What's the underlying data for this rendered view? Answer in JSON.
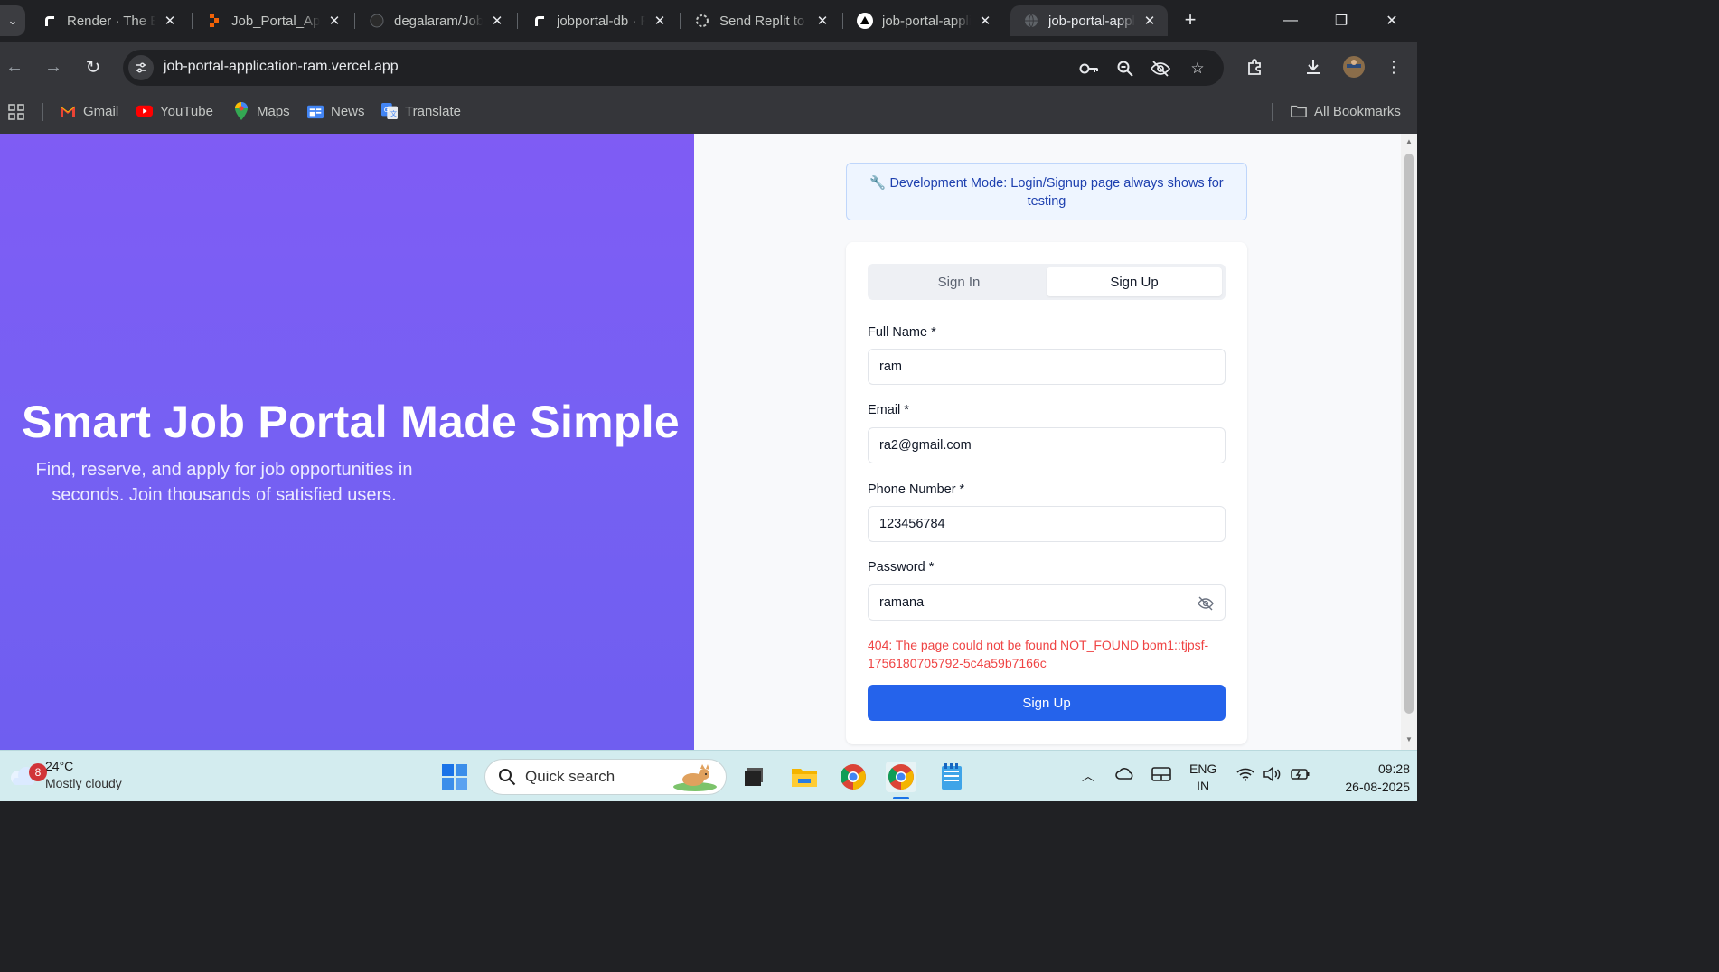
{
  "browser": {
    "tabs": [
      {
        "title": "Render · The Best Cloud",
        "favicon": "render-icon",
        "active": false
      },
      {
        "title": "Job_Portal_Application",
        "favicon": "replit-icon",
        "active": false
      },
      {
        "title": "degalaram/Job_Portal",
        "favicon": "github-icon",
        "active": false
      },
      {
        "title": "jobportal-db · Render",
        "favicon": "render-icon",
        "active": false
      },
      {
        "title": "Send Replit to Vercel",
        "favicon": "chatgpt-icon",
        "active": false
      },
      {
        "title": "job-portal-application",
        "favicon": "vercel-icon",
        "active": false
      },
      {
        "title": "job-portal-application",
        "favicon": "globe-icon",
        "active": true
      }
    ],
    "url": "job-portal-application-ram.vercel.app",
    "bookmarks": [
      {
        "label": "Gmail",
        "icon": "gmail-icon"
      },
      {
        "label": "YouTube",
        "icon": "youtube-icon"
      },
      {
        "label": "Maps",
        "icon": "maps-icon"
      },
      {
        "label": "News",
        "icon": "news-icon"
      },
      {
        "label": "Translate",
        "icon": "translate-icon"
      }
    ],
    "all_bookmarks": "All Bookmarks"
  },
  "hero": {
    "title": "Smart Job Portal Made Simple",
    "subtitle": "Find, reserve, and apply for job opportunities in seconds. Join thousands of satisfied users."
  },
  "auth": {
    "dev_notice": "🔧 Development Mode: Login/Signup page always shows for testing",
    "tabs": {
      "sign_in": "Sign In",
      "sign_up": "Sign Up"
    },
    "active_tab": "Sign Up",
    "fields": {
      "full_name": {
        "label": "Full Name *",
        "value": "ram"
      },
      "email": {
        "label": "Email *",
        "value": "ra2@gmail.com"
      },
      "phone": {
        "label": "Phone Number *",
        "value": "123456784"
      },
      "password": {
        "label": "Password *",
        "value": "ramana"
      }
    },
    "error": "404: The page could not be found NOT_FOUND bom1::tjpsf-1756180705792-5c4a59b7166c",
    "submit_label": "Sign Up",
    "colors": {
      "primary": "#2563eb",
      "error": "#ef4444",
      "hero_gradient": "#7f5cf4"
    }
  },
  "taskbar": {
    "weather_badge": "8",
    "temperature": "24°C",
    "condition": "Mostly cloudy",
    "search_placeholder": "Quick search",
    "lang_top": "ENG",
    "lang_bottom": "IN",
    "time": "09:28",
    "date": "26-08-2025"
  }
}
